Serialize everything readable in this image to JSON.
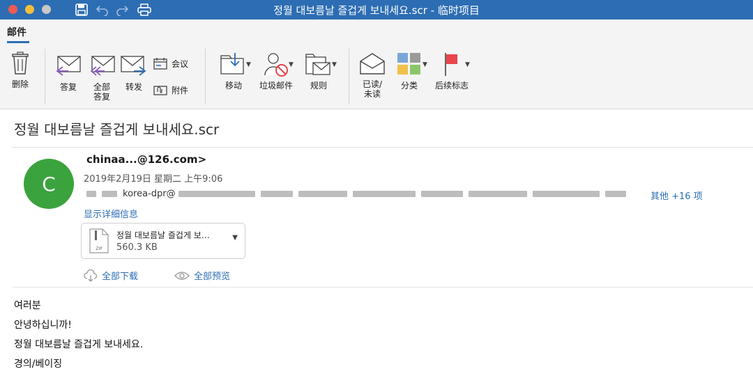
{
  "window": {
    "title": "정월 대보름날 즐겁게 보내세요.scr - 临时项目"
  },
  "ribbon": {
    "tab": "邮件",
    "delete": "删除",
    "reply": "答复",
    "reply_all": "全部\n答复",
    "forward": "转发",
    "meeting": "会议",
    "attachment": "附件",
    "move": "移动",
    "junk": "垃圾邮件",
    "rules": "规则",
    "read_unread": "已读/\n未读",
    "categorize": "分类",
    "follow_up": "后续标志"
  },
  "message": {
    "subject": "정월 대보름날 즐겁게 보내세요.scr",
    "avatar_letter": "C",
    "from": "chinaa...@126.com>",
    "date": "2019年2月19日 星期二 上午9:06",
    "recipients_visible": "korea-dpr@",
    "others": "其他 +16 项",
    "show_details": "显示详细信息",
    "attachment": {
      "name": "정월 대보름날 즐겁게 보…",
      "size": "560.3 KB",
      "type_label": "ZIP"
    },
    "download_all": "全部下载",
    "preview_all": "全部预览",
    "body": [
      "여러분",
      "안녕하십니까!",
      "정월 대보름날 즐겁게 보내세요.",
      "경의/베이징"
    ]
  },
  "colors": {
    "accent": "#2d6db3",
    "avatar": "#3aa33d",
    "flag": "#e8464b"
  }
}
